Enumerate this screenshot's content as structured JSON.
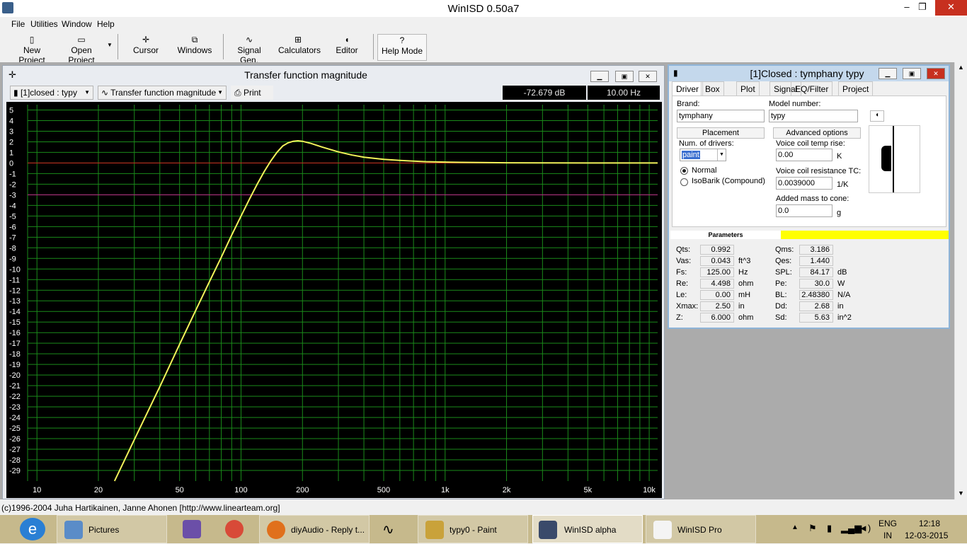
{
  "window": {
    "title": "WinISD 0.50a7",
    "controls": {
      "minimize": "–",
      "maximize": "❐",
      "close": "✕"
    }
  },
  "menu": [
    "File",
    "Utilities",
    "Window",
    "Help"
  ],
  "toolbar": {
    "new_project": "New Project",
    "open_project": "Open Project",
    "cursor": "Cursor",
    "windows": "Windows",
    "signal_gen": "Signal Gen.",
    "calculators": "Calculators",
    "editor": "Editor",
    "help_mode": "Help Mode"
  },
  "chart_window": {
    "title": "Transfer function magnitude",
    "project_select": "[1]closed : typy",
    "graph_select": "Transfer function magnitude",
    "print": "Print",
    "readout_db": "-72.679 dB",
    "readout_hz": "10.00 Hz"
  },
  "chart_data": {
    "type": "line",
    "title": "Transfer function magnitude",
    "xlabel": "",
    "ylabel": "",
    "xscale": "log",
    "xlim": [
      9,
      11000
    ],
    "ylim": [
      -30,
      5.5
    ],
    "x_ticks": [
      {
        "v": 10,
        "l": "10"
      },
      {
        "v": 20,
        "l": "20"
      },
      {
        "v": 50,
        "l": "50"
      },
      {
        "v": 100,
        "l": "100"
      },
      {
        "v": 200,
        "l": "200"
      },
      {
        "v": 500,
        "l": "500"
      },
      {
        "v": 1000,
        "l": "1k"
      },
      {
        "v": 2000,
        "l": "2k"
      },
      {
        "v": 5000,
        "l": "5k"
      },
      {
        "v": 10000,
        "l": "10k"
      }
    ],
    "y_ticks": [
      5,
      4,
      3,
      2,
      1,
      0,
      -1,
      -2,
      -3,
      -4,
      -5,
      -6,
      -7,
      -8,
      -9,
      -10,
      -11,
      -12,
      -13,
      -14,
      -15,
      -16,
      -17,
      -18,
      -19,
      -20,
      -21,
      -22,
      -23,
      -24,
      -25,
      -26,
      -27,
      -28,
      -29
    ],
    "reference_lines": [
      {
        "y": 0,
        "color": "#d02020"
      },
      {
        "y": -3,
        "color": "#c0208a"
      }
    ],
    "grid": true,
    "colors": {
      "background": "#000000",
      "grid": "#1a8a1a",
      "line": "#f2f25a",
      "axis_text": "#ffffff"
    },
    "series": [
      {
        "x": [
          24,
          30,
          40,
          50,
          60,
          70,
          80,
          90,
          100,
          110,
          120,
          130,
          140,
          150,
          160,
          170,
          180,
          190,
          200,
          220,
          250,
          300,
          350,
          400,
          500,
          600,
          700,
          800,
          1000,
          1200,
          1500,
          2000,
          3000,
          5000,
          7000,
          10000,
          11000
        ],
        "values": [
          -30,
          -26.1,
          -21.1,
          -17.1,
          -13.9,
          -11.2,
          -8.9,
          -6.8,
          -5.0,
          -3.4,
          -2.0,
          -0.8,
          0.2,
          1.0,
          1.6,
          1.9,
          2.05,
          2.1,
          2.05,
          1.85,
          1.5,
          1.05,
          0.75,
          0.55,
          0.35,
          0.25,
          0.18,
          0.13,
          0.09,
          0.06,
          0.04,
          0.02,
          0.01,
          0.0,
          0.0,
          0.0,
          0.0
        ]
      }
    ]
  },
  "driver_window": {
    "title": "[1]Closed : tymphany typy",
    "tabs": [
      "Driver",
      "Box",
      "Plot",
      "Signal",
      "EQ/Filter",
      "Project"
    ],
    "brand_label": "Brand:",
    "brand": "tymphany",
    "model_label": "Model number:",
    "model": "typy",
    "placement": "Placement",
    "advanced": "Advanced options",
    "num_drivers_label": "Num. of drivers:",
    "num_drivers": "paint",
    "radio_normal": "Normal",
    "radio_isobarik": "IsoBarik (Compound)",
    "vc_temp_label": "Voice coil temp rise:",
    "vc_temp": "0.00",
    "vc_temp_unit": "K",
    "vc_res_label": "Voice coil resistance TC:",
    "vc_res": "0.0039000",
    "vc_res_unit": "1/K",
    "mass_label": "Added mass to cone:",
    "mass": "0.0",
    "mass_unit": "g",
    "params_header": "Parameters",
    "params_left": [
      {
        "k": "Qts:",
        "v": "0.992",
        "u": ""
      },
      {
        "k": "Vas:",
        "v": "0.043",
        "u": "ft^3"
      },
      {
        "k": "Fs:",
        "v": "125.00",
        "u": "Hz"
      },
      {
        "k": "Re:",
        "v": "4.498",
        "u": "ohm"
      },
      {
        "k": "Le:",
        "v": "0.00",
        "u": "mH"
      },
      {
        "k": "Xmax:",
        "v": "2.50",
        "u": "in"
      },
      {
        "k": "Z:",
        "v": "6.000",
        "u": "ohm"
      }
    ],
    "params_right": [
      {
        "k": "Qms:",
        "v": "3.186",
        "u": ""
      },
      {
        "k": "Qes:",
        "v": "1.440",
        "u": ""
      },
      {
        "k": "SPL:",
        "v": "84.17",
        "u": "dB"
      },
      {
        "k": "Pe:",
        "v": "30.0",
        "u": "W"
      },
      {
        "k": "BL:",
        "v": "2.48380",
        "u": "N/A"
      },
      {
        "k": "Dd:",
        "v": "2.68",
        "u": "in"
      },
      {
        "k": "Sd:",
        "v": "5.63",
        "u": "in^2"
      }
    ]
  },
  "status": "(c)1996-2004 Juha Hartikainen, Janne Ahonen [http://www.linearteam.org]",
  "taskbar": {
    "items": [
      "Pictures",
      "diyAudio - Reply t...",
      "typy0 - Paint",
      "WinISD alpha",
      "WinISD Pro"
    ],
    "lang": "ENG",
    "region": "IN",
    "time": "12:18",
    "date": "12-03-2015"
  }
}
